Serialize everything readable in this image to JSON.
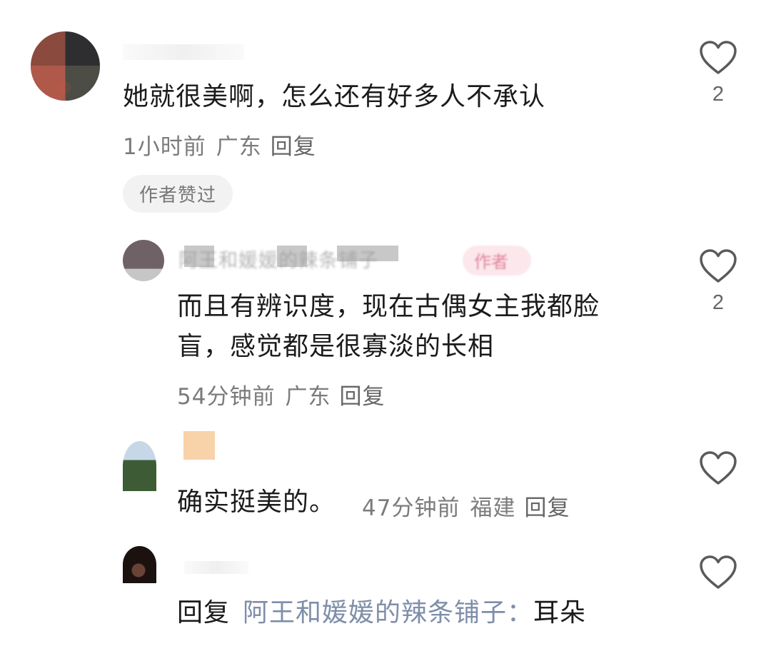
{
  "comments": [
    {
      "text": "她就很美啊，怎么还有好多人不承认",
      "time": "1小时前",
      "location": "广东",
      "reply": "回复",
      "badge": "作者赞过",
      "likes": "2"
    },
    {
      "username": "阿王和媛媛的辣条铺子",
      "author_tag": "作者",
      "text_line1": "而且有辨识度，现在古偶女主我都脸",
      "text_line2": "盲，感觉都是很寡淡的长相",
      "time": "54分钟前",
      "location": "广东",
      "reply": "回复",
      "likes": "2"
    },
    {
      "text": "确实挺美的。",
      "time": "47分钟前",
      "location": "福建",
      "reply": "回复"
    },
    {
      "reply_prefix": "回复",
      "reply_target": "阿王和媛媛的辣条铺子：",
      "text": "耳朵"
    }
  ],
  "icons": {
    "like": "heart-outline-icon"
  },
  "colors": {
    "text": "#1b1b1b",
    "meta": "#7b7b7b",
    "reply_target": "#7f8ea9",
    "badge_bg": "#f2f2f2"
  }
}
